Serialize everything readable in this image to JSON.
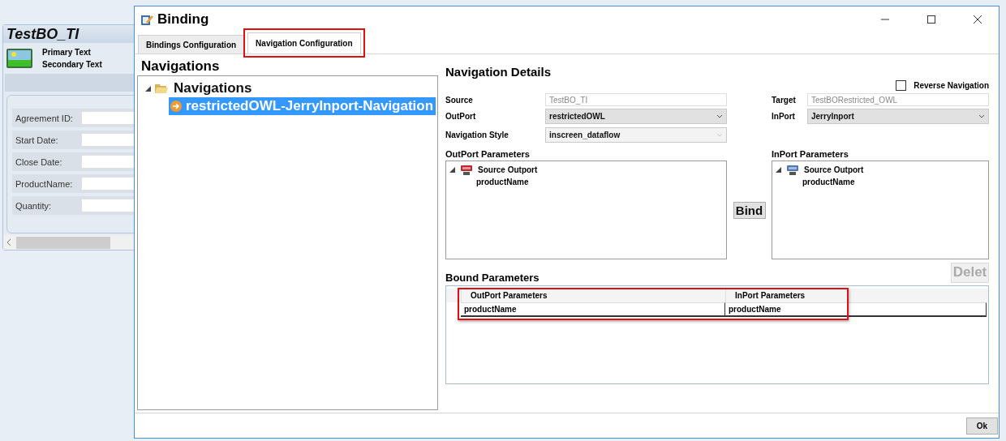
{
  "background_app": {
    "title": "TestBO_TI",
    "primary_text": "Primary Text",
    "secondary_text": "Secondary Text",
    "fields": [
      {
        "label": "Agreement ID:"
      },
      {
        "label": "Start Date:"
      },
      {
        "label": "Close Date:"
      },
      {
        "label": "ProductName:"
      },
      {
        "label": "Quantity:"
      }
    ]
  },
  "dialog": {
    "title": "Binding",
    "tabs": [
      {
        "label": "Bindings Configuration",
        "selected": false,
        "highlighted": false
      },
      {
        "label": "Navigation Configuration",
        "selected": true,
        "highlighted": true
      }
    ],
    "navigations": {
      "heading": "Navigations",
      "tree": [
        {
          "label": "Navigations",
          "expanded": true,
          "selected": false,
          "children": [
            {
              "label": "restrictedOWL-JerryInport-Navigation",
              "selected": true
            }
          ]
        }
      ]
    },
    "details": {
      "heading": "Navigation Details",
      "reverse_navigation": {
        "label": "Reverse Navigation",
        "checked": false
      },
      "source": {
        "label": "Source",
        "value": "TestBO_TI",
        "kind": "text",
        "disabled": true
      },
      "target": {
        "label": "Target",
        "value": "TestBORestricted_OWL",
        "kind": "text",
        "disabled": true
      },
      "outport": {
        "label": "OutPort",
        "value": "restrictedOWL",
        "kind": "select",
        "disabled": false
      },
      "inport": {
        "label": "InPort",
        "value": "JerryInport",
        "kind": "select",
        "disabled": false
      },
      "navigation_style": {
        "label": "Navigation Style",
        "value": "inscreen_dataflow",
        "kind": "select",
        "disabled": true
      },
      "outport_parameters": {
        "heading": "OutPort Parameters",
        "tree": [
          {
            "label": "Source Outport",
            "kind": "outport",
            "expanded": true,
            "children": [
              {
                "label": "productName"
              }
            ]
          }
        ]
      },
      "inport_parameters": {
        "heading": "InPort Parameters",
        "tree": [
          {
            "label": "Source Outport",
            "kind": "inport",
            "expanded": true,
            "children": [
              {
                "label": "productName"
              }
            ]
          }
        ]
      },
      "bind_button": {
        "label": "Bind",
        "disabled": false
      },
      "bound_parameters": {
        "heading": "Bound Parameters",
        "delete_button": {
          "label": "Delet",
          "disabled": true
        },
        "highlighted": true,
        "columns": [
          "OutPort Parameters",
          "InPort Parameters"
        ],
        "rows": [
          [
            "productName",
            "productName"
          ]
        ]
      }
    },
    "ok_button": {
      "label": "Ok"
    }
  }
}
